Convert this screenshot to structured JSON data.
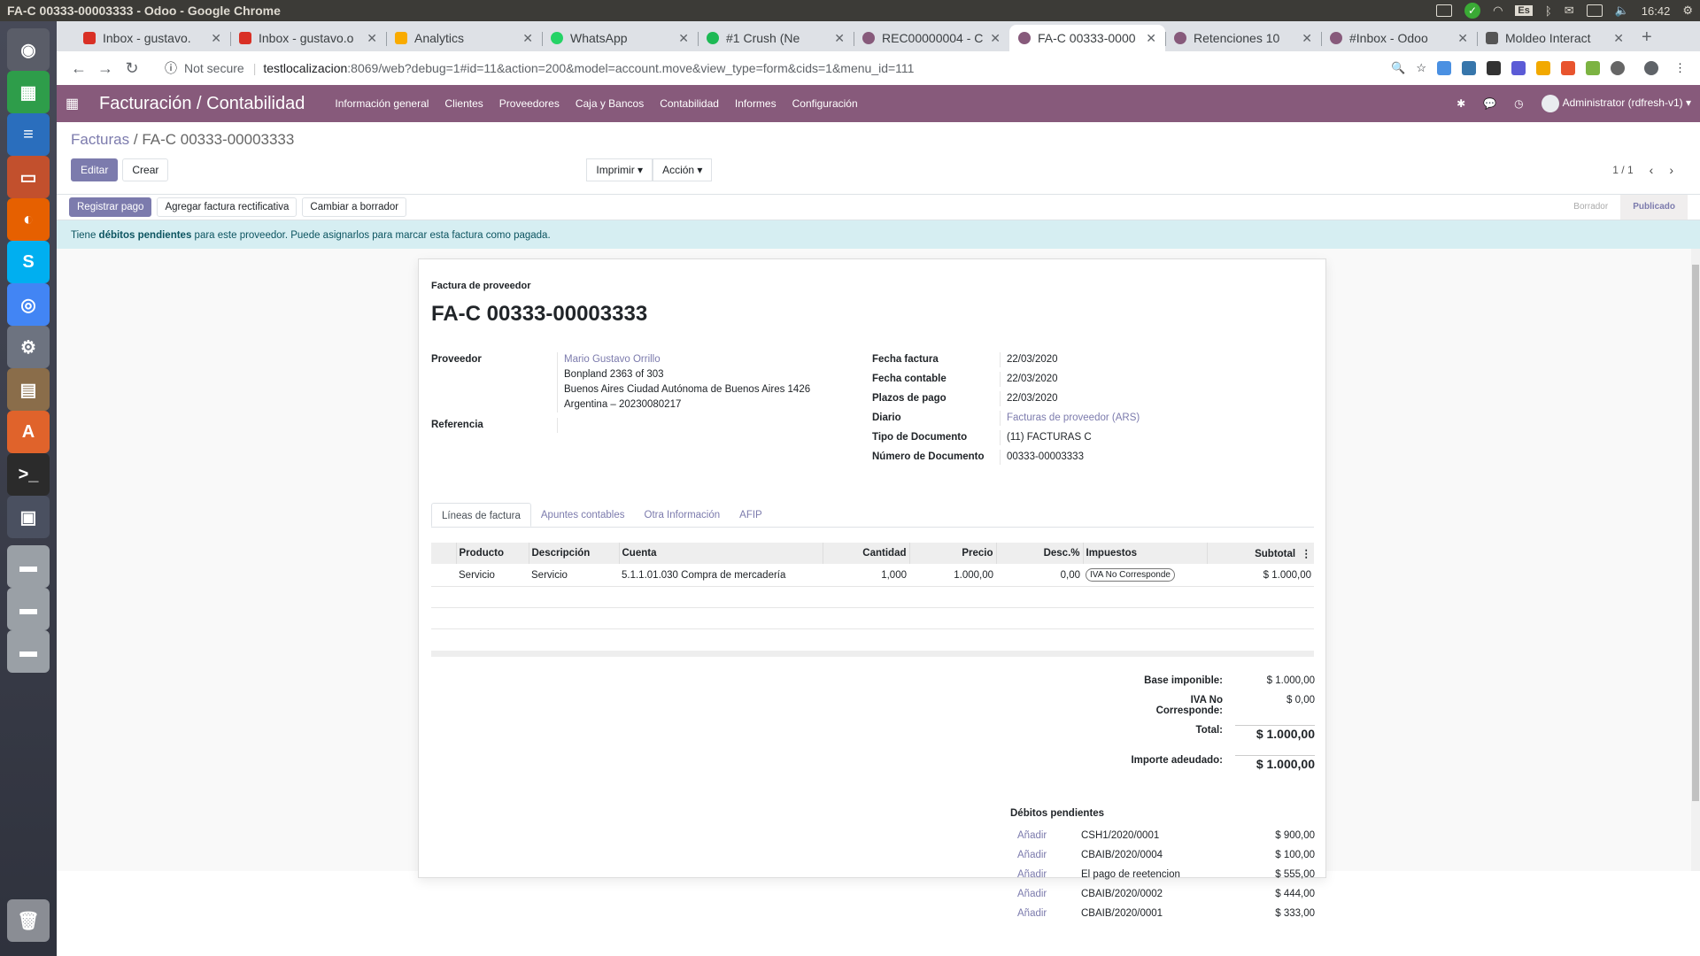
{
  "os": {
    "window_title": "FA-C 00333-00003333 - Odoo - Google Chrome",
    "lang": "Es",
    "clock": "16:42"
  },
  "browser": {
    "tabs": [
      {
        "label": "Inbox - gustavo.",
        "color": "#d93025",
        "active": false
      },
      {
        "label": "Inbox - gustavo.o",
        "color": "#d93025",
        "active": false
      },
      {
        "label": "Analytics",
        "color": "#f9ab00",
        "active": false
      },
      {
        "label": "WhatsApp",
        "color": "#25d366",
        "active": false
      },
      {
        "label": "#1 Crush (Ne",
        "color": "#1db954",
        "active": false
      },
      {
        "label": "REC00000004 - C",
        "color": "#875a7b",
        "active": false
      },
      {
        "label": "FA-C 00333-0000",
        "color": "#875a7b",
        "active": true
      },
      {
        "label": "Retenciones 10",
        "color": "#875a7b",
        "active": false
      },
      {
        "label": "#Inbox - Odoo",
        "color": "#875a7b",
        "active": false
      },
      {
        "label": "Moldeo Interact",
        "color": "#555555",
        "active": false
      }
    ],
    "security": "Not secure",
    "url_host": "testlocalizacion",
    "url_rest": ":8069/web?debug=1#id=11&action=200&model=account.move&view_type=form&cids=1&menu_id=111"
  },
  "navbar": {
    "brand": "Facturación / Contabilidad",
    "menu": [
      "Información general",
      "Clientes",
      "Proveedores",
      "Caja y Bancos",
      "Contabilidad",
      "Informes",
      "Configuración"
    ],
    "user": "Administrator (rdfresh-v1)"
  },
  "control_panel": {
    "breadcrumb_parent": "Facturas",
    "breadcrumb_current": "FA-C 00333-00003333",
    "edit": "Editar",
    "create": "Crear",
    "print": "Imprimir",
    "action": "Acción",
    "pager": "1 / 1"
  },
  "statusbar": {
    "register_payment": "Registrar pago",
    "add_refund": "Agregar factura rectificativa",
    "reset_draft": "Cambiar a borrador",
    "states": [
      "Borrador",
      "Publicado"
    ]
  },
  "alert": {
    "prefix": "Tiene",
    "bold": "débitos pendientes",
    "suffix": "para este proveedor. Puede asignarlos para marcar esta factura como pagada."
  },
  "invoice": {
    "type": "Factura de proveedor",
    "name": "FA-C 00333-00003333",
    "labels": {
      "partner": "Proveedor",
      "reference": "Referencia",
      "invoice_date": "Fecha factura",
      "accounting_date": "Fecha contable",
      "payment_terms": "Plazos de pago",
      "journal": "Diario",
      "doc_type": "Tipo de Documento",
      "doc_number": "Número de Documento"
    },
    "partner_name": "Mario Gustavo Orrillo",
    "partner_addr": [
      "Bonpland 2363 of 303",
      "Buenos Aires Ciudad Autónoma de Buenos Aires 1426",
      "Argentina – 20230080217"
    ],
    "invoice_date": "22/03/2020",
    "accounting_date": "22/03/2020",
    "payment_terms": "22/03/2020",
    "journal": "Facturas de proveedor (ARS)",
    "doc_type": "(11) FACTURAS C",
    "doc_number": "00333-00003333"
  },
  "tabs": [
    "Líneas de factura",
    "Apuntes contables",
    "Otra Información",
    "AFIP"
  ],
  "lines": {
    "headers": [
      "Producto",
      "Descripción",
      "Cuenta",
      "Cantidad",
      "Precio",
      "Desc.%",
      "Impuestos",
      "Subtotal"
    ],
    "rows": [
      {
        "product": "Servicio",
        "description": "Servicio",
        "account": "5.1.1.01.030 Compra de mercadería",
        "qty": "1,000",
        "price": "1.000,00",
        "disc": "0,00",
        "tax": "IVA No Corresponde",
        "subtotal": "$ 1.000,00"
      }
    ]
  },
  "totals": {
    "base_label": "Base imponible:",
    "base": "$ 1.000,00",
    "iva_label": "IVA No Corresponde:",
    "iva": "$ 0,00",
    "total_label": "Total:",
    "total": "$ 1.000,00",
    "due_label": "Importe adeudado:",
    "due": "$ 1.000,00"
  },
  "outstanding": {
    "title": "Débitos pendientes",
    "add_label": "Añadir",
    "items": [
      {
        "ref": "CSH1/2020/0001",
        "amount": "$ 900,00"
      },
      {
        "ref": "CBAIB/2020/0004",
        "amount": "$ 100,00"
      },
      {
        "ref": "El pago de reetencion",
        "amount": "$ 555,00"
      },
      {
        "ref": "CBAIB/2020/0002",
        "amount": "$ 444,00"
      },
      {
        "ref": "CBAIB/2020/0001",
        "amount": "$ 333,00"
      }
    ]
  }
}
